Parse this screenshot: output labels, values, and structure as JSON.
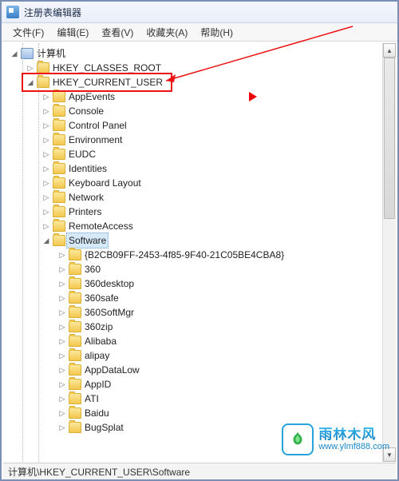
{
  "window": {
    "title": "注册表编辑器"
  },
  "menu": {
    "file": "文件(F)",
    "edit": "编辑(E)",
    "view": "查看(V)",
    "fav": "收藏夹(A)",
    "help": "帮助(H)"
  },
  "tree": {
    "root": "计算机",
    "hkcr": "HKEY_CLASSES_ROOT",
    "hkcu": "HKEY_CURRENT_USER",
    "hkcu_children": [
      "AppEvents",
      "Console",
      "Control Panel",
      "Environment",
      "EUDC",
      "Identities",
      "Keyboard Layout",
      "Network",
      "Printers",
      "RemoteAccess"
    ],
    "software": "Software",
    "sw_children": [
      "{B2CB09FF-2453-4f85-9F40-21C05BE4CBA8}",
      "360",
      "360desktop",
      "360safe",
      "360SoftMgr",
      "360zip",
      "Alibaba",
      "alipay",
      "AppDataLow",
      "AppID",
      "ATI",
      "Baidu",
      "BugSplat"
    ]
  },
  "status": {
    "path": "计算机\\HKEY_CURRENT_USER\\Software"
  },
  "logo": {
    "cn": "雨林木风",
    "url": "www.ylmf888.com"
  },
  "icons": {
    "computer": "computer-icon",
    "folder": "folder-icon"
  },
  "glyph": {
    "collapsed": "▷",
    "expanded": "◢"
  }
}
